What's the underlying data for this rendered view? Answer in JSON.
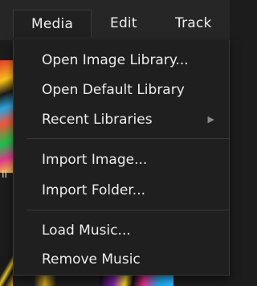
{
  "menubar": {
    "menus": [
      "Media",
      "Edit",
      "Track"
    ]
  },
  "dropdown": {
    "items": [
      {
        "label": "Open Image Library..."
      },
      {
        "label": "Open Default Library"
      },
      {
        "label": "Recent Libraries",
        "submenu_arrow": "▶"
      },
      {
        "label": "Import Image..."
      },
      {
        "label": "Import Folder..."
      },
      {
        "label": "Load Music..."
      },
      {
        "label": "Remove Music"
      }
    ]
  },
  "background": {
    "partial_label": "II"
  }
}
